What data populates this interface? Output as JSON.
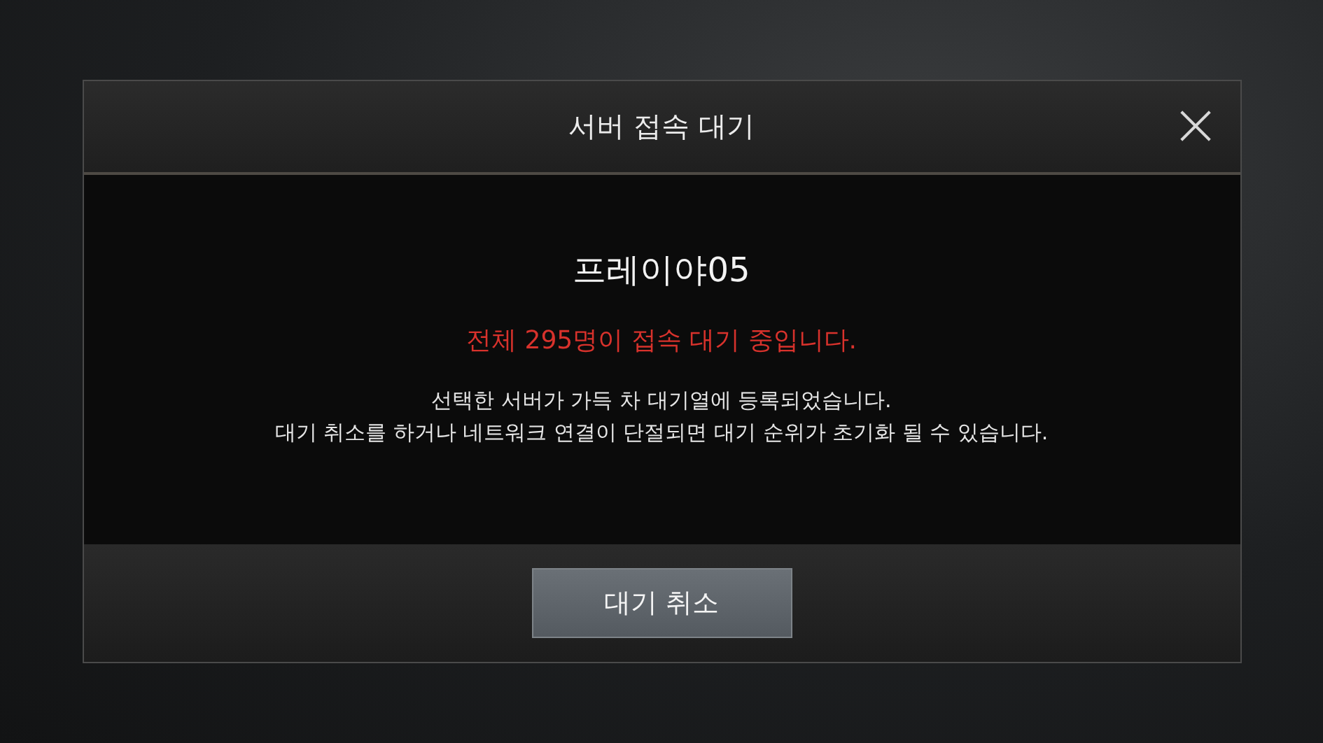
{
  "dialog": {
    "title": "서버 접속 대기",
    "server_name": "프레이야05",
    "queue_notice": "전체 295명이 접속 대기 중입니다.",
    "message_lines": [
      "선택한 서버가 가득 차 대기열에 등록되었습니다.",
      "대기 취소를 하거나 네트워크 연결이 단절되면 대기 순위가 초기화 될 수 있습니다."
    ],
    "buttons": [
      "대기 취소"
    ]
  }
}
